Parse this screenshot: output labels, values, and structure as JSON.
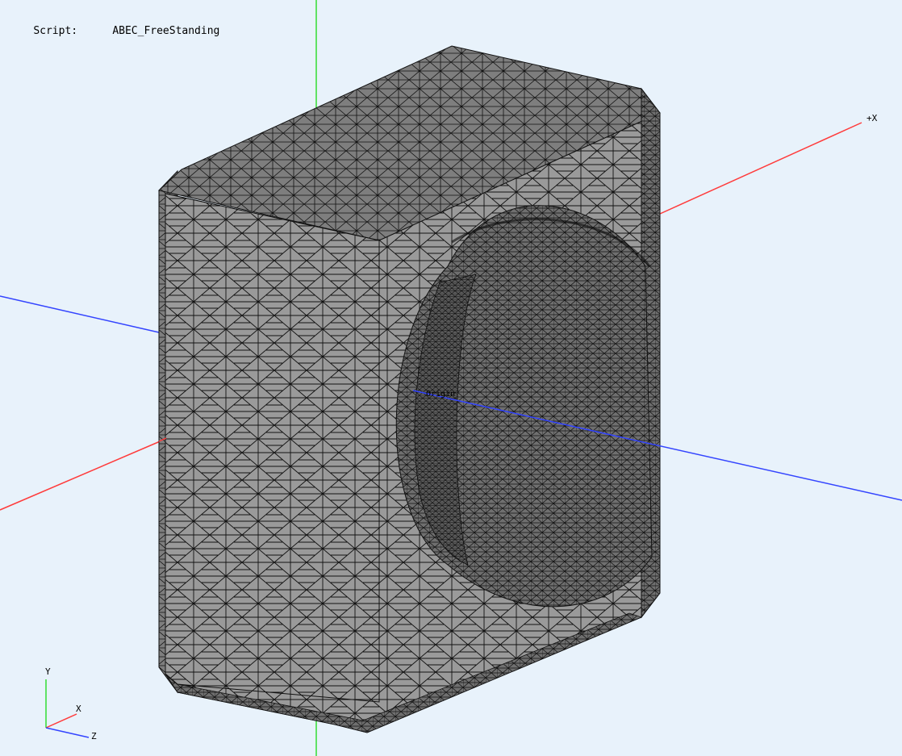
{
  "header": {
    "script_label": "Script:",
    "script_name": "ABEC_FreeStanding"
  },
  "viewport": {
    "background_color": "#e8f2fb",
    "mesh_face_color": "#9a9a9a",
    "mesh_side_color": "#7e7e7e",
    "mesh_top_color": "#8a8a8a",
    "mesh_line_color": "#111111"
  },
  "axes": {
    "x_label": "+X",
    "x_color": "#ff3b3b",
    "y_color": "#33dd33",
    "z_color": "#3344ff",
    "origin_label": "Origin"
  },
  "triad": {
    "y_label": "Y",
    "x_label": "X",
    "z_label": "Z"
  }
}
